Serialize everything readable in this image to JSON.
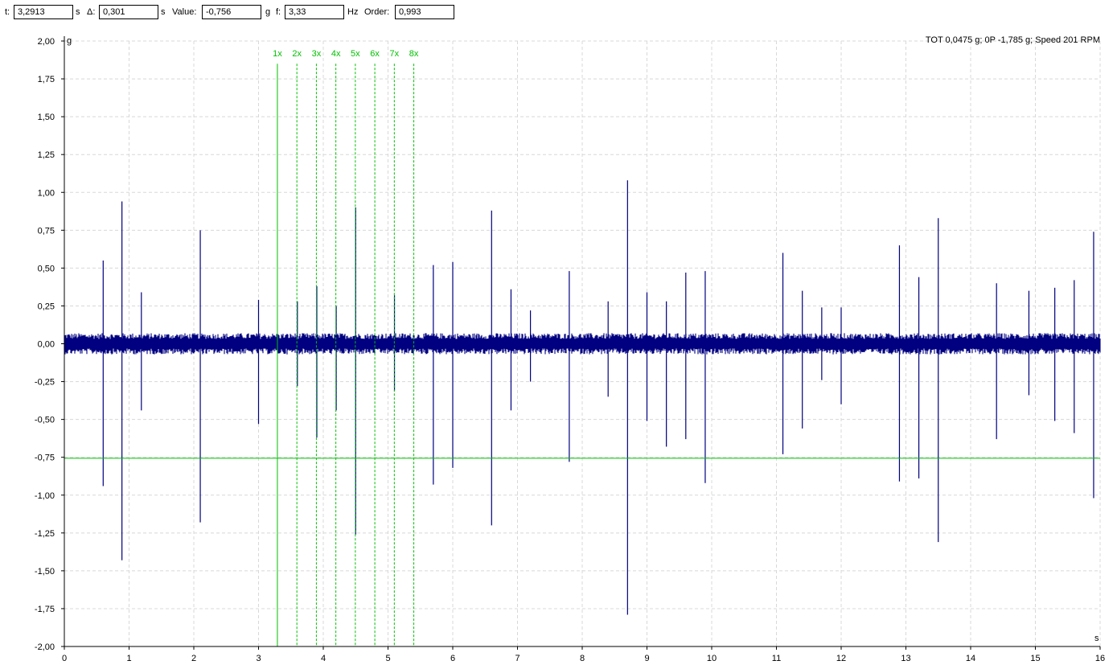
{
  "toolbar": {
    "t_label": "t:",
    "t_value": "3,2913",
    "t_unit": "s",
    "delta_label": "Δ:",
    "delta_value": "0,301",
    "delta_unit": "s",
    "value_label": "Value:",
    "value_value": "-0,756",
    "value_unit": "g",
    "f_label": "f:",
    "f_value": "3,33",
    "f_unit": "Hz",
    "order_label": "Order:",
    "order_value": "0,993"
  },
  "chart_data": {
    "type": "line",
    "title": "",
    "info_text": "TOT 0,0475 g; 0P -1,785 g; Speed 201 RPM",
    "xlabel": "s",
    "ylabel": "g",
    "xlim": [
      0,
      16
    ],
    "ylim": [
      -2,
      2
    ],
    "x_ticks": [
      "0",
      "1",
      "2",
      "3",
      "4",
      "5",
      "6",
      "7",
      "8",
      "9",
      "10",
      "11",
      "12",
      "13",
      "14",
      "15",
      "16"
    ],
    "y_ticks": [
      "2,00",
      "1,75",
      "1,50",
      "1,25",
      "1,00",
      "0,75",
      "0,50",
      "0,25",
      "0,00",
      "-0,25",
      "-0,50",
      "-0,75",
      "-1,00",
      "-1,25",
      "-1,50",
      "-1,75",
      "-2,00"
    ],
    "grid": true,
    "series": [
      {
        "color": "#000080",
        "noise_amplitude": 0.07,
        "spikes": [
          {
            "x": 0.6,
            "max": 0.55,
            "min": -0.94
          },
          {
            "x": 0.89,
            "max": 0.94,
            "min": -1.43
          },
          {
            "x": 1.19,
            "max": 0.34,
            "min": -0.44
          },
          {
            "x": 2.1,
            "max": 0.75,
            "min": -1.18
          },
          {
            "x": 3.0,
            "max": 0.29,
            "min": -0.53
          },
          {
            "x": 3.6,
            "max": 0.28,
            "min": -0.28
          },
          {
            "x": 3.9,
            "max": 0.38,
            "min": -0.62
          },
          {
            "x": 4.2,
            "max": 0.25,
            "min": -0.44
          },
          {
            "x": 4.5,
            "max": 0.9,
            "min": -1.26
          },
          {
            "x": 5.1,
            "max": 0.32,
            "min": -0.31
          },
          {
            "x": 5.7,
            "max": 0.52,
            "min": -0.93
          },
          {
            "x": 6.0,
            "max": 0.54,
            "min": -0.82
          },
          {
            "x": 6.6,
            "max": 0.88,
            "min": -1.2
          },
          {
            "x": 6.9,
            "max": 0.36,
            "min": -0.44
          },
          {
            "x": 7.2,
            "max": 0.22,
            "min": -0.25
          },
          {
            "x": 7.8,
            "max": 0.48,
            "min": -0.78
          },
          {
            "x": 8.4,
            "max": 0.28,
            "min": -0.35
          },
          {
            "x": 8.7,
            "max": 1.08,
            "min": -1.79
          },
          {
            "x": 9.0,
            "max": 0.34,
            "min": -0.51
          },
          {
            "x": 9.3,
            "max": 0.28,
            "min": -0.68
          },
          {
            "x": 9.6,
            "max": 0.47,
            "min": -0.63
          },
          {
            "x": 9.9,
            "max": 0.48,
            "min": -0.92
          },
          {
            "x": 11.1,
            "max": 0.6,
            "min": -0.73
          },
          {
            "x": 11.4,
            "max": 0.35,
            "min": -0.56
          },
          {
            "x": 11.7,
            "max": 0.24,
            "min": -0.24
          },
          {
            "x": 12.0,
            "max": 0.24,
            "min": -0.4
          },
          {
            "x": 12.9,
            "max": 0.65,
            "min": -0.91
          },
          {
            "x": 13.2,
            "max": 0.44,
            "min": -0.89
          },
          {
            "x": 13.5,
            "max": 0.83,
            "min": -1.31
          },
          {
            "x": 14.4,
            "max": 0.4,
            "min": -0.63
          },
          {
            "x": 14.9,
            "max": 0.35,
            "min": -0.34
          },
          {
            "x": 15.3,
            "max": 0.37,
            "min": -0.51
          },
          {
            "x": 15.6,
            "max": 0.42,
            "min": -0.59
          },
          {
            "x": 15.9,
            "max": 0.74,
            "min": -1.02
          }
        ]
      }
    ],
    "cursor": {
      "color": "#00c000",
      "x": 3.2913,
      "y": -0.756,
      "order_count": 8,
      "harmonic_labels": [
        "1x",
        "2x",
        "3x",
        "4x",
        "5x",
        "6x",
        "7x",
        "8x"
      ],
      "harmonic_x": [
        3.2913,
        3.5923,
        3.8933,
        4.1943,
        4.4953,
        4.7963,
        5.0973,
        5.3983
      ],
      "harmonic_top": 1.85
    }
  }
}
